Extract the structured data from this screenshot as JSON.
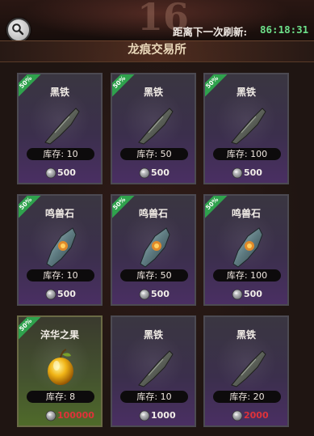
{
  "header": {
    "bg_number": "16",
    "refresh_label": "距离下一次刷新:",
    "refresh_time": "86:18:31"
  },
  "panel": {
    "title": "龙痕交易所"
  },
  "colors": {
    "ribbon": "#2fa24d",
    "timer": "#6de08a",
    "price_red": "#e0323a",
    "card_purple": "#4a2f63",
    "card_gold": "#4f6a2a"
  },
  "items": [
    {
      "name": "黑铁",
      "discount": "50%",
      "stock": "库存: 10",
      "price": "500",
      "icon": "black-iron-icon",
      "price_color": "normal",
      "card": "purple"
    },
    {
      "name": "黑铁",
      "discount": "50%",
      "stock": "库存: 50",
      "price": "500",
      "icon": "black-iron-icon",
      "price_color": "normal",
      "card": "purple"
    },
    {
      "name": "黑铁",
      "discount": "50%",
      "stock": "库存: 100",
      "price": "500",
      "icon": "black-iron-icon",
      "price_color": "normal",
      "card": "purple"
    },
    {
      "name": "鸣兽石",
      "discount": "50%",
      "stock": "库存: 10",
      "price": "500",
      "icon": "beast-stone-icon",
      "price_color": "normal",
      "card": "purple"
    },
    {
      "name": "鸣兽石",
      "discount": "50%",
      "stock": "库存: 50",
      "price": "500",
      "icon": "beast-stone-icon",
      "price_color": "normal",
      "card": "purple"
    },
    {
      "name": "鸣兽石",
      "discount": "50%",
      "stock": "库存: 100",
      "price": "500",
      "icon": "beast-stone-icon",
      "price_color": "normal",
      "card": "purple"
    },
    {
      "name": "淬华之果",
      "discount": "50%",
      "stock": "库存: 8",
      "price": "100000",
      "icon": "golden-fruit-icon",
      "price_color": "red",
      "card": "gold"
    },
    {
      "name": "黑铁",
      "discount": "",
      "stock": "库存: 10",
      "price": "1000",
      "icon": "black-iron-icon",
      "price_color": "normal",
      "card": "purple"
    },
    {
      "name": "黑铁",
      "discount": "",
      "stock": "库存: 20",
      "price": "2000",
      "icon": "black-iron-icon",
      "price_color": "red",
      "card": "purple"
    }
  ]
}
